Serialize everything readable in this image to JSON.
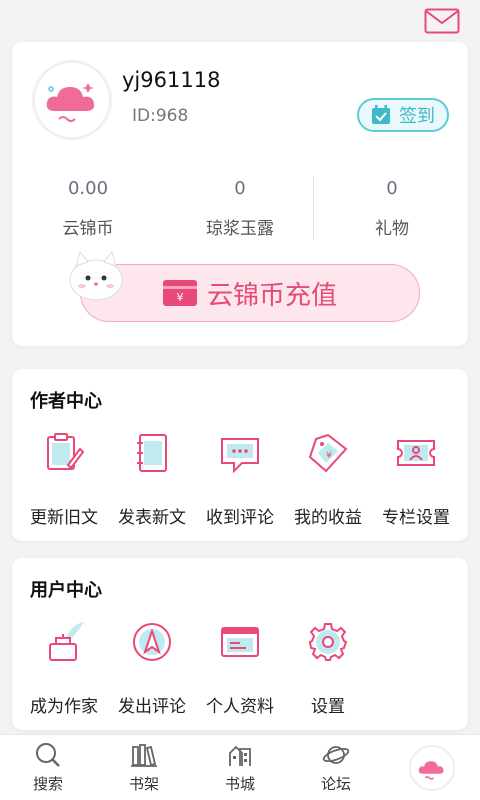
{
  "profile": {
    "username": "yj961118",
    "user_id": "ID:968",
    "checkin_label": "签到",
    "stats": [
      {
        "value": "0.00",
        "label": "云锦币"
      },
      {
        "value": "0",
        "label": "琼浆玉露"
      },
      {
        "value": "0",
        "label": "礼物"
      }
    ],
    "recharge_label": "云锦币充值"
  },
  "author_center": {
    "title": "作者中心",
    "items": [
      {
        "label": "更新旧文",
        "icon": "clipboard-edit-icon"
      },
      {
        "label": "发表新文",
        "icon": "notebook-icon"
      },
      {
        "label": "收到评论",
        "icon": "comment-bubble-icon"
      },
      {
        "label": "我的收益",
        "icon": "price-tag-icon"
      },
      {
        "label": "专栏设置",
        "icon": "ticket-profile-icon"
      }
    ]
  },
  "user_center": {
    "title": "用户中心",
    "items": [
      {
        "label": "成为作家",
        "icon": "quill-inkpot-icon"
      },
      {
        "label": "发出评论",
        "icon": "compass-arrow-icon"
      },
      {
        "label": "个人资料",
        "icon": "id-card-icon"
      },
      {
        "label": "设置",
        "icon": "gear-icon"
      }
    ]
  },
  "bottom_nav": [
    {
      "label": "搜索",
      "icon": "search-icon"
    },
    {
      "label": "书架",
      "icon": "bookshelf-icon"
    },
    {
      "label": "书城",
      "icon": "bookstore-icon"
    },
    {
      "label": "论坛",
      "icon": "planet-forum-icon"
    },
    {
      "label": "",
      "icon": "cloud-avatar-icon"
    }
  ],
  "colors": {
    "accent_pink": "#e8497a",
    "accent_cyan": "#3fb9c6",
    "background": "#f3f3f5"
  }
}
